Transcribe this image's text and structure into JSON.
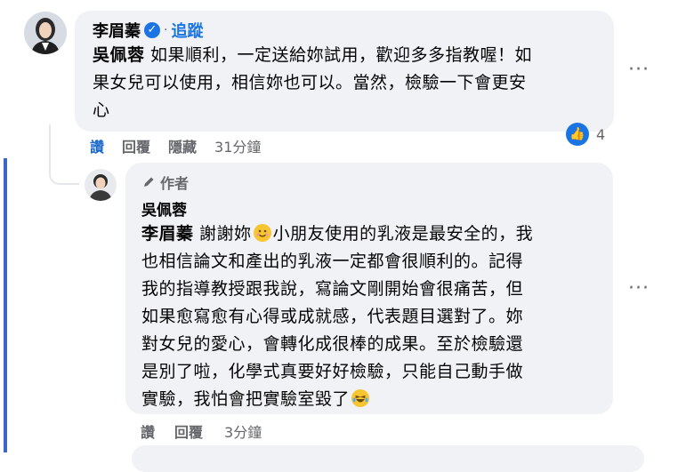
{
  "comment1": {
    "author": "李眉蓁",
    "verified_icon": "verified-badge-icon",
    "follow_label": "追蹤",
    "mention": "吳佩蓉",
    "lines": [
      " 如果順利，一定送給妳試用，歡迎多多指教喔！如",
      "果女兒可以使用，相信妳也可以。當然，檢驗一下會更安",
      "心"
    ],
    "actions": {
      "like": "讚",
      "reply": "回覆",
      "hide": "隱藏",
      "time": "31分鐘"
    },
    "reaction_count": "4",
    "more_label": "···"
  },
  "comment2": {
    "author_tag_icon": "pencil-icon",
    "author_tag": "作者",
    "author": "吳佩蓉",
    "mention": "李眉蓁",
    "line1_a": " 謝謝妳",
    "line1_b": "小朋友使用的乳液是最安全的，我",
    "lines": [
      "也相信論文和產出的乳液一定都會很順利的。記得",
      "我的指導教授跟我說，寫論文剛開始會很痛苦，但",
      "如果愈寫愈有心得或成就感，代表題目選對了。妳",
      "對女兒的愛心，會轉化成很棒的成果。至於檢驗還",
      "是別了啦，化學式真要好好檢驗，只能自己動手做"
    ],
    "last_line": "實驗，我怕會把實驗室毀了",
    "emoji1": "smiling-face-emoji",
    "emoji2": "laughing-face-emoji",
    "actions": {
      "like": "讚",
      "reply": "回覆",
      "time": "3分鐘"
    },
    "more_label": "···"
  },
  "colors": {
    "accent": "#1b74e4",
    "thread": "#3b68c8",
    "bubble": "#f0f2f5",
    "muted": "#65676b"
  }
}
